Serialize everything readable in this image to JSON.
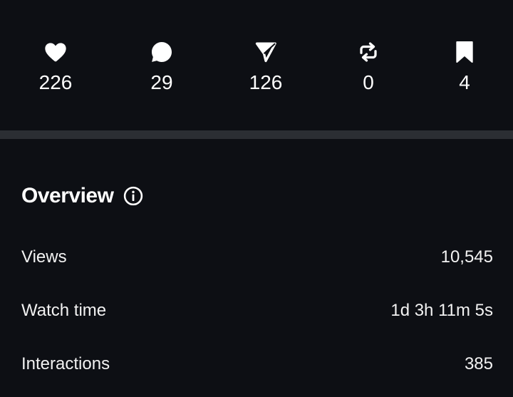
{
  "stats": [
    {
      "icon": "heart-icon",
      "count": "226"
    },
    {
      "icon": "comment-icon",
      "count": "29"
    },
    {
      "icon": "send-icon",
      "count": "126"
    },
    {
      "icon": "repost-icon",
      "count": "0"
    },
    {
      "icon": "bookmark-icon",
      "count": "4"
    }
  ],
  "overview": {
    "title": "Overview",
    "info_icon": "info-icon",
    "metrics": [
      {
        "label": "Views",
        "value": "10,545"
      },
      {
        "label": "Watch time",
        "value": "1d 3h 11m 5s"
      },
      {
        "label": "Interactions",
        "value": "385"
      }
    ]
  },
  "colors": {
    "background": "#0d0f14",
    "divider": "#2b2e33",
    "text": "#ffffff"
  }
}
